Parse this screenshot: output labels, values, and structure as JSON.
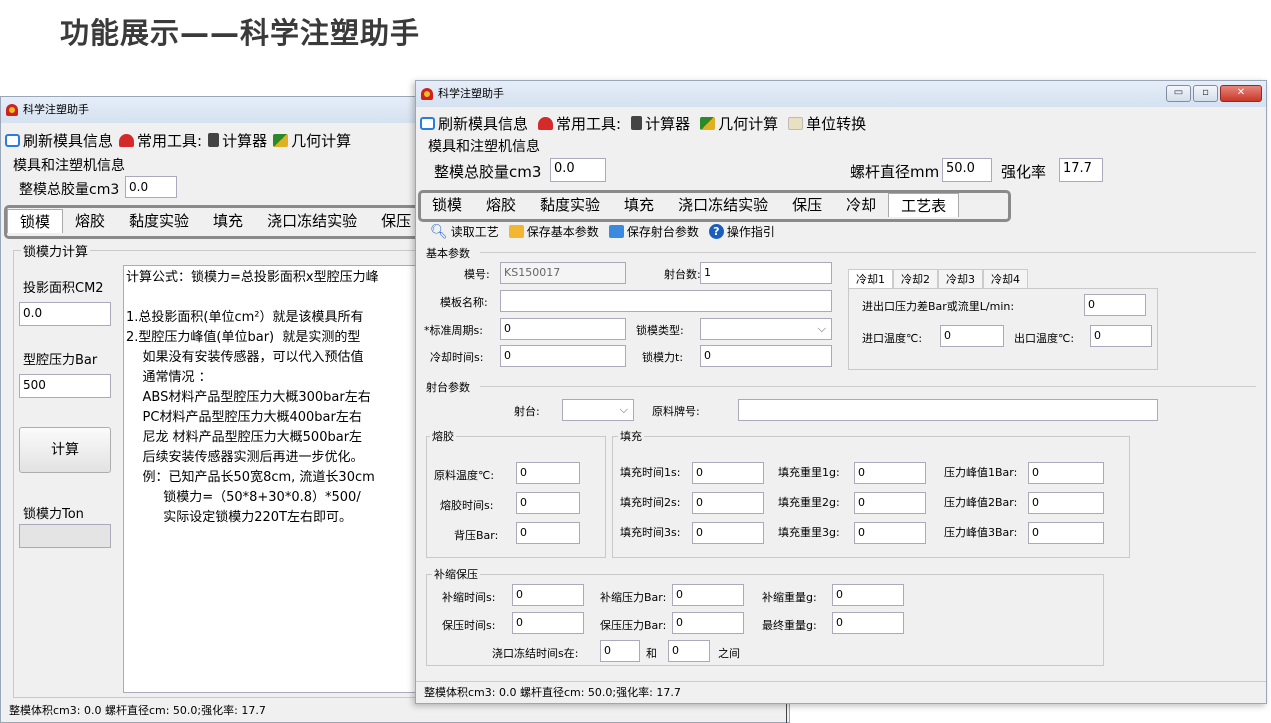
{
  "slide": {
    "title": "功能展示——科学注塑助手"
  },
  "back_window": {
    "title": "科学注塑助手",
    "menu": {
      "refresh": "刷新模具信息",
      "tools": "常用工具:",
      "calc": "计算器",
      "geo": "几何计算"
    },
    "mold_info_label": "模具和注塑机信息",
    "total_label": "整模总胶量cm3",
    "total_value": "0.0",
    "tabs": [
      "锁模",
      "熔胶",
      "黏度实验",
      "填充",
      "浇口冻结实验",
      "保压"
    ],
    "clamp_group": "锁模力计算",
    "proj_area_label": "投影面积CM2",
    "proj_area_value": "0.0",
    "cavity_pressure_label": "型腔压力Bar",
    "cavity_pressure_value": "500",
    "calc_button": "计算",
    "clamp_force_label": "锁模力Ton",
    "formula_lines": [
      "计算公式：锁模力=总投影面积x型腔压力峰",
      "",
      "1.总投影面积(单位cm²）就是该模具所有",
      "2.型腔压力峰值(单位bar)  就是实测的型",
      "    如果没有安装传感器，可以代入预估值",
      "    通常情况 ：",
      "    ABS材料产品型腔压力大概300bar左右",
      "    PC材料产品型腔压力大概400bar左右",
      "    尼龙 材料产品型腔压力大概500bar左",
      "    后续安装传感器实测后再进一步优化。",
      "    例：已知产品长50宽8cm, 流道长30cm",
      "         锁模力=（50*8+30*0.8）*500/",
      "         实际设定锁模力220T左右即可。"
    ],
    "status": "整模体积cm3: 0.0  螺杆直径cm: 50.0;强化率: 17.7"
  },
  "front_window": {
    "title": "科学注塑助手",
    "window_buttons": {
      "minimize": "▭",
      "maximize": "▫",
      "close": "✕"
    },
    "menu": {
      "refresh": "刷新模具信息",
      "tools": "常用工具:",
      "calc": "计算器",
      "geo": "几何计算",
      "unit": "单位转换"
    },
    "mold_info_label": "模具和注塑机信息",
    "total_label": "整模总胶量cm3",
    "total_value": "0.0",
    "screw_label": "螺杆直径mm",
    "screw_value": "50.0",
    "ratio_label": "强化率",
    "ratio_value": "17.7",
    "tabs": [
      "锁模",
      "熔胶",
      "黏度实验",
      "填充",
      "浇口冻结实验",
      "保压",
      "冷却",
      "工艺表"
    ],
    "toolbar": {
      "read": "读取工艺",
      "save_basic": "保存基本参数",
      "save_shot": "保存射台参数",
      "guide": "操作指引"
    },
    "basic": {
      "title": "基本参数",
      "mold_no_label": "模号:",
      "mold_no_value": "KS150017",
      "shots_label": "射台数:",
      "shots_value": "1",
      "template_label": "模板名称:",
      "cycle_label": "*标准周期s:",
      "cycle_value": "0",
      "clamp_type_label": "锁模类型:",
      "cool_time_label": "冷却时间s:",
      "cool_time_value": "0",
      "clamp_force_label": "锁模力t:",
      "clamp_force_value": "0",
      "cool_tabs": [
        "冷却1",
        "冷却2",
        "冷却3",
        "冷却4"
      ],
      "pressure_diff_label": "进出口压力差Bar或流里L/min:",
      "pressure_diff_value": "0",
      "in_temp_label": "进口温度℃:",
      "in_temp_value": "0",
      "out_temp_label": "出口温度℃:",
      "out_temp_value": "0"
    },
    "shot": {
      "title": "射台参数",
      "shot_label": "射台:",
      "material_label": "原料牌号:",
      "melt_title": "熔胶",
      "melt_temp_label": "原料温度℃:",
      "melt_temp_value": "0",
      "melt_time_label": "熔胶时间s:",
      "melt_time_value": "0",
      "back_pressure_label": "背压Bar:",
      "back_pressure_value": "0",
      "fill_title": "填充",
      "fill_rows": [
        {
          "time_label": "填充时间1s:",
          "time": "0",
          "weight_label": "填充重里1g:",
          "weight": "0",
          "peak_label": "压力峰值1Bar:",
          "peak": "0"
        },
        {
          "time_label": "填充时间2s:",
          "time": "0",
          "weight_label": "填充重里2g:",
          "weight": "0",
          "peak_label": "压力峰值2Bar:",
          "peak": "0"
        },
        {
          "time_label": "填充时间3s:",
          "time": "0",
          "weight_label": "填充重里3g:",
          "weight": "0",
          "peak_label": "压力峰值3Bar:",
          "peak": "0"
        }
      ],
      "hold_title": "补缩保压",
      "feed_time_label": "补缩时间s:",
      "feed_time_value": "0",
      "feed_pressure_label": "补缩压力Bar:",
      "feed_pressure_value": "0",
      "feed_weight_label": "补缩重量g:",
      "feed_weight_value": "0",
      "hold_time_label": "保压时间s:",
      "hold_time_value": "0",
      "hold_pressure_label": "保压压力Bar:",
      "hold_pressure_value": "0",
      "final_weight_label": "最终重量g:",
      "final_weight_value": "0",
      "gate_label": "浇口冻结时间s在:",
      "gate_from": "0",
      "gate_and": "和",
      "gate_to": "0",
      "gate_between": "之间"
    },
    "status": "整模体积cm3: 0.0  螺杆直径cm: 50.0;强化率: 17.7"
  }
}
